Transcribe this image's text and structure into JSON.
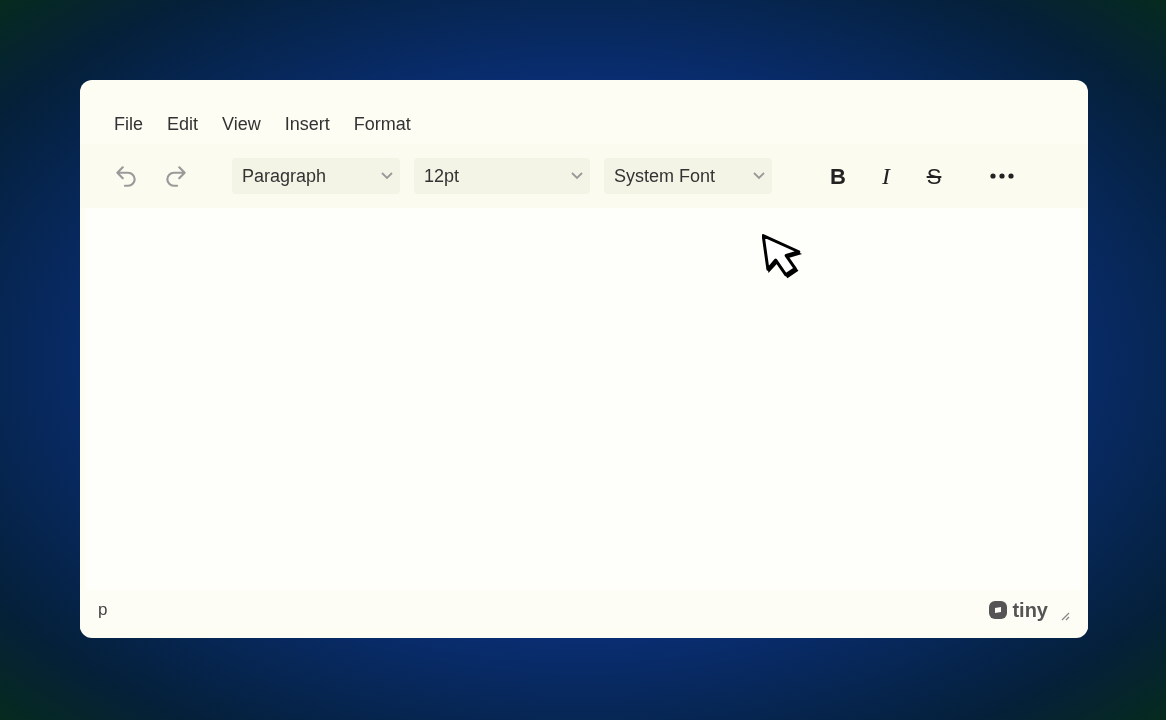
{
  "menu_bar": [
    {
      "label": "File"
    },
    {
      "label": "Edit"
    },
    {
      "label": "View"
    },
    {
      "label": "Insert"
    },
    {
      "label": "Format"
    }
  ],
  "history_buttons": [
    {
      "kind": "undo",
      "disabled": true
    },
    {
      "kind": "redo",
      "disabled": true
    }
  ],
  "dropdowns": [
    {
      "value": "Paragraph"
    },
    {
      "value": "12pt"
    },
    {
      "value": "System Font"
    }
  ],
  "format_buttons": [
    {
      "label": "B",
      "kind": "bold"
    },
    {
      "label": "I",
      "kind": "italic"
    },
    {
      "label": "S",
      "kind": "strikethrough"
    }
  ],
  "status_bar": {
    "path": "p",
    "logo": "tiny"
  }
}
